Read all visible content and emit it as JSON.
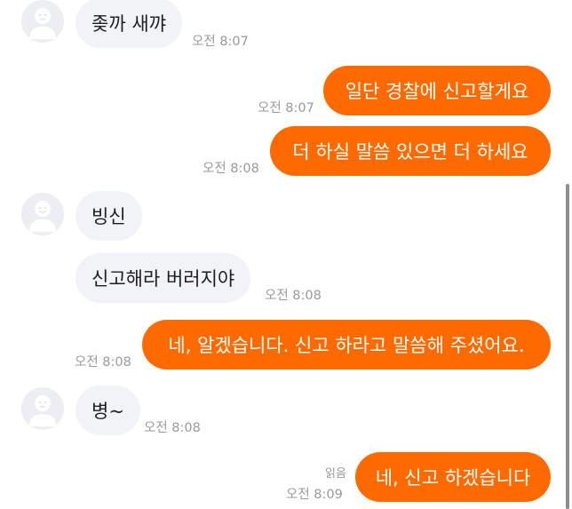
{
  "messages": [
    {
      "text": "좆까 새꺄",
      "time": "오전 8:07"
    },
    {
      "text": "일단 경찰에 신고할게요",
      "time": "오전 8:07"
    },
    {
      "text": "더 하실 말씀 있으면 더 하세요",
      "time": "오전 8:08"
    },
    {
      "text": "빙신",
      "time": ""
    },
    {
      "text": "신고해라 버러지야",
      "time": "오전 8:08"
    },
    {
      "text": "네, 알겠습니다. 신고 하라고 말씀해 주셨어요.",
      "time": "오전 8:08"
    },
    {
      "text": "병~",
      "time": "오전 8:08"
    },
    {
      "text": "네, 신고 하겠습니다",
      "time": "오전 8:09",
      "read": "읽음"
    }
  ],
  "colors": {
    "outgoing_bubble": "#ff6a00",
    "incoming_bubble": "#f2f3f6",
    "timestamp": "#9a9a9a"
  },
  "icons": {
    "avatar": "default-avatar-icon"
  }
}
